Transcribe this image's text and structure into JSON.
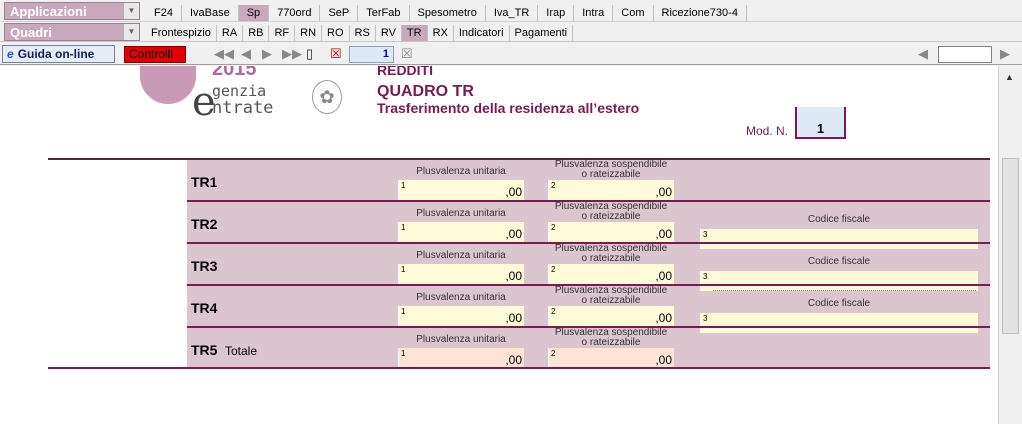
{
  "toolbar1": {
    "combo_label": "Applicazioni",
    "tabs": [
      "F24",
      "IvaBase",
      "Sp",
      "770ord",
      "SeP",
      "TerFab",
      "Spesometro",
      "Iva_TR",
      "Irap",
      "Intra",
      "Com",
      "Ricezione730-4"
    ],
    "active": "Sp"
  },
  "toolbar2": {
    "combo_label": "Quadri",
    "tabs": [
      "Frontespizio",
      "RA",
      "RB",
      "RF",
      "RN",
      "RO",
      "RS",
      "RV",
      "TR",
      "RX",
      "Indicatori",
      "Pagamenti"
    ],
    "active": "TR"
  },
  "toolbar3": {
    "guida_label": "Guida on-line",
    "controlli_label": "Controlli",
    "page_number": "1",
    "right_value": ""
  },
  "header": {
    "logo_year": "2015",
    "logo_line1": "genzia",
    "logo_line2": "ntrate",
    "redditi": "REDDITI",
    "quadro": "QUADRO TR",
    "subtitle": "Trasferimento della residenza all’estero",
    "mod_n_label": "Mod. N.",
    "mod_n_value": "1"
  },
  "labels": {
    "plus_unitaria": "Plusvalenza unitaria",
    "plus_sosp_1": "Plusvalenza sospendibile",
    "plus_sosp_2": "o rateizzabile",
    "codice_fiscale": "Codice fiscale",
    "decimals": ",00",
    "totale": "Totale",
    "n1": "1",
    "n2": "2",
    "n3": "3"
  },
  "rows": [
    {
      "code": "TR1"
    },
    {
      "code": "TR2"
    },
    {
      "code": "TR3"
    },
    {
      "code": "TR4"
    },
    {
      "code": "TR5"
    }
  ],
  "colors": {
    "accent": "#7a1a52",
    "form_bg": "#dbc6d0",
    "field_yellow": "#fffbd8",
    "field_peach": "#fde4d4",
    "active_tab": "#c8a8bc",
    "controlli_red": "#e00000"
  }
}
